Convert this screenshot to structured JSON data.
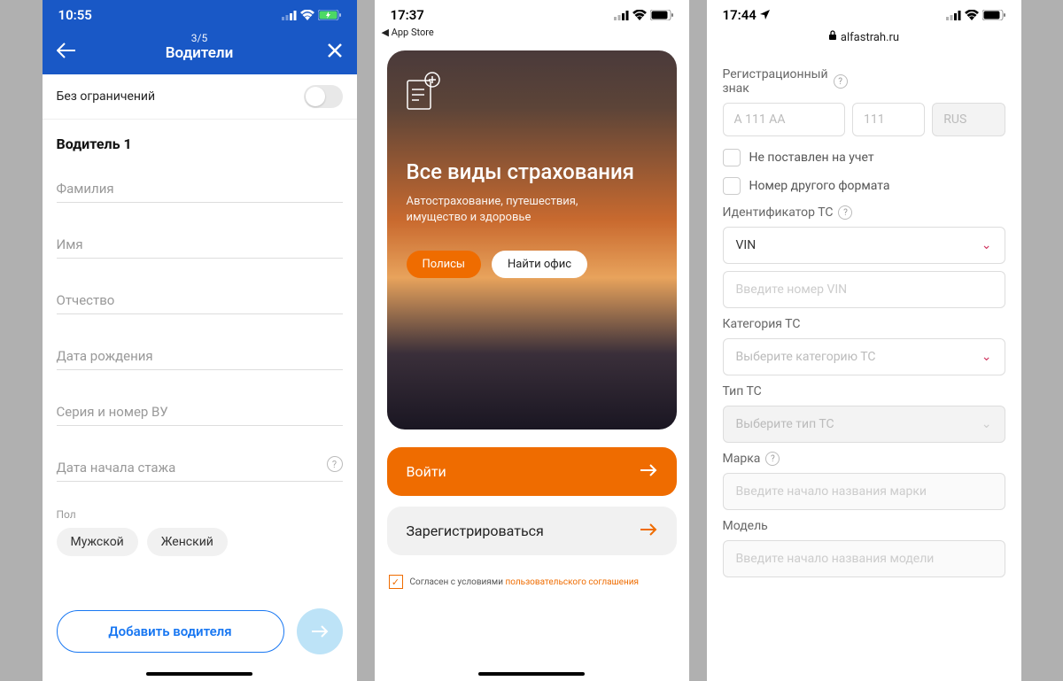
{
  "screen1": {
    "status": {
      "time": "10:55"
    },
    "header": {
      "step": "3/5",
      "title": "Водители"
    },
    "toggle_label": "Без ограничений",
    "driver_heading": "Водитель 1",
    "fields": {
      "surname": "Фамилия",
      "name": "Имя",
      "patronymic": "Отчество",
      "birthdate": "Дата рождения",
      "license": "Серия и номер ВУ",
      "exp_start": "Дата начала стажа"
    },
    "gender_label": "Пол",
    "gender": {
      "male": "Мужской",
      "female": "Женский"
    },
    "add_driver_btn": "Добавить водителя"
  },
  "screen2": {
    "status": {
      "time": "17:37"
    },
    "back_app": "◀ App Store",
    "hero": {
      "title": "Все виды страхования",
      "subtitle": "Автострахование, путешествия, имущество и здоровье",
      "btn_policies": "Полисы",
      "btn_office": "Найти офис"
    },
    "login_btn": "Войти",
    "register_btn": "Зарегистрироваться",
    "consent_prefix": "Согласен с условиями ",
    "consent_link": "пользовательского соглашения"
  },
  "screen3": {
    "status": {
      "time": "17:44"
    },
    "url": "alfastrah.ru",
    "reg_label_l1": "Регистрационный",
    "reg_label_l2": "знак",
    "plate": {
      "letters_ph": "A 111 AA",
      "region_ph": "111",
      "country": "RUS"
    },
    "check1": "Не поставлен на учет",
    "check2": "Номер другого формата",
    "id_label": "Идентификатор ТС",
    "id_select": "VIN",
    "vin_ph": "Введите номер VIN",
    "cat_label": "Категория ТС",
    "cat_ph": "Выберите категорию ТС",
    "type_label": "Тип ТС",
    "type_ph": "Выберите тип ТС",
    "brand_label": "Марка",
    "brand_ph": "Введите начало названия марки",
    "model_label": "Модель",
    "model_ph": "Введите начало названия модели"
  }
}
